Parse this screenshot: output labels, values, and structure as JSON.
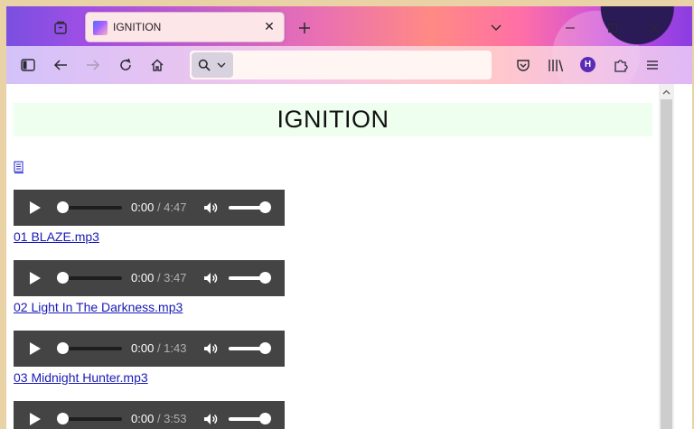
{
  "tabs": [
    {
      "title": "IGNITION",
      "active": true
    }
  ],
  "toolbar": {
    "account_initial": "H"
  },
  "page": {
    "heading": "IGNITION",
    "playlist_icon": "playlist-file-icon"
  },
  "tracks": [
    {
      "file": "01 BLAZE.mp3",
      "current": "0:00",
      "duration": "/ 4:47"
    },
    {
      "file": "02 Light In The Darkness.mp3",
      "current": "0:00",
      "duration": "/ 3:47"
    },
    {
      "file": "03 Midnight Hunter.mp3",
      "current": "0:00",
      "duration": "/ 1:43"
    },
    {
      "file": "",
      "current": "0:00",
      "duration": "/ 3:53"
    }
  ],
  "colors": {
    "heading_bg": "#efffef",
    "player_bg": "#444444",
    "link": "#1a1ab8"
  }
}
